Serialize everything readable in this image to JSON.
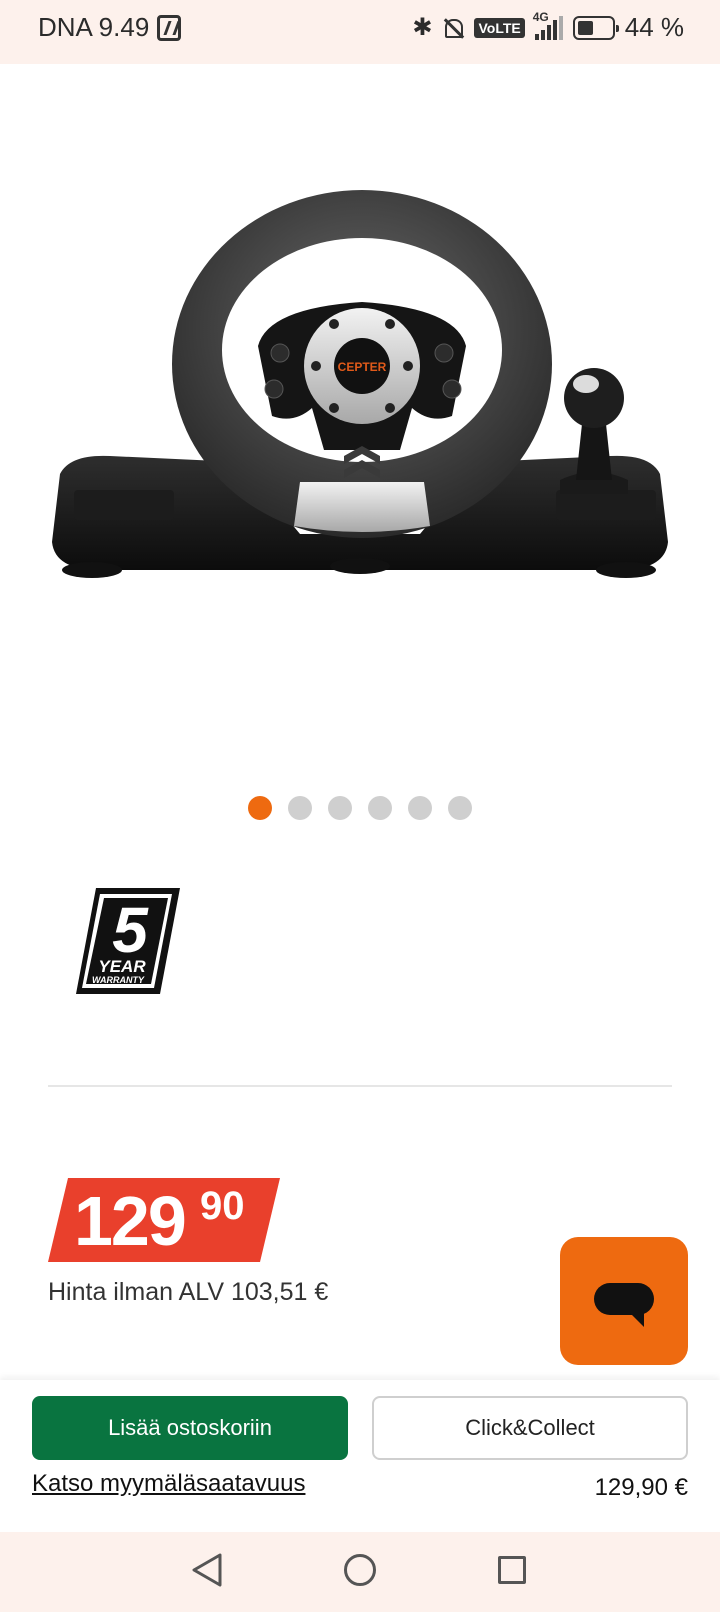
{
  "status_bar": {
    "carrier_time": "DNA 9.49",
    "volte": "VoLTE",
    "network": "4G",
    "battery": "44 %"
  },
  "product": {
    "image_brand_text": "CEPTER",
    "carousel": {
      "total": 6,
      "active_index": 0
    },
    "warranty": {
      "number": "5",
      "year": "YEAR",
      "label": "WARRANTY"
    },
    "price": {
      "main": "129",
      "cents": "90"
    },
    "vat_text": "Hinta ilman ALV 103,51 €"
  },
  "bottom_bar": {
    "add_to_cart_label": "Lisää ostoskoriin",
    "click_collect_label": "Click&Collect",
    "store_availability_link": "Katso myymäläsaatavuus",
    "total_price": "129,90 €"
  },
  "colors": {
    "accent_orange": "#ee6a10",
    "price_red": "#e9402c",
    "cart_green": "#097440"
  }
}
